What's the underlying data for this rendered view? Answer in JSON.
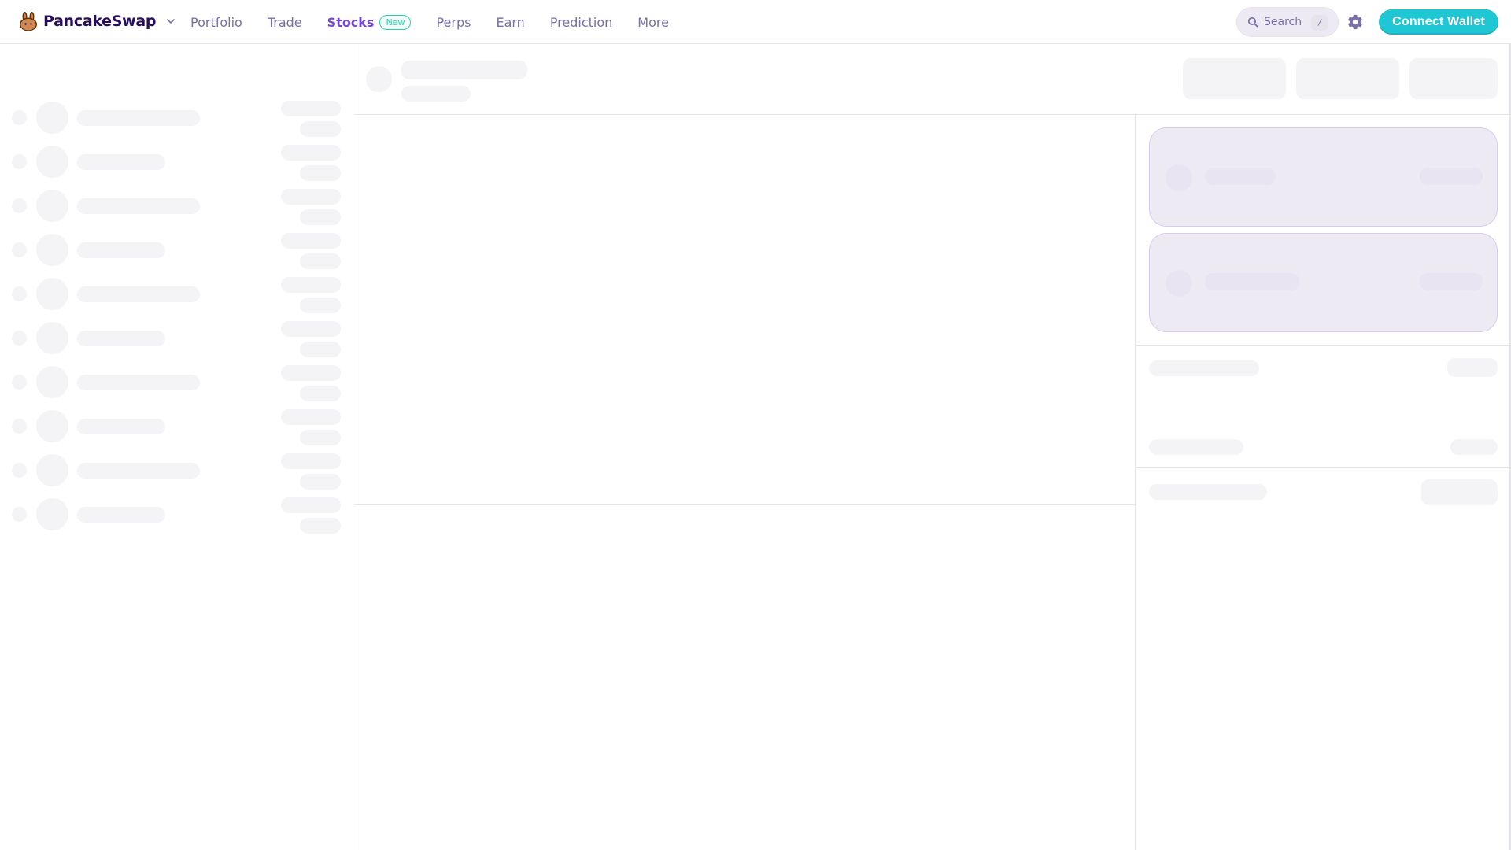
{
  "app": {
    "brand": "PancakeSwap",
    "accent_color": "#7645d9",
    "brand_color": "#1fc7d4",
    "text_color": "#280d5f",
    "muted_color": "#7a6eaa"
  },
  "nav": {
    "items": [
      {
        "label": "Portfolio",
        "active": false
      },
      {
        "label": "Trade",
        "active": false
      },
      {
        "label": "Stocks",
        "active": true,
        "badge": "New"
      },
      {
        "label": "Perps",
        "active": false
      },
      {
        "label": "Earn",
        "active": false
      },
      {
        "label": "Prediction",
        "active": false
      },
      {
        "label": "More",
        "active": false
      }
    ]
  },
  "search": {
    "label": "Search",
    "shortcut": "/"
  },
  "connect_label": "Connect Wallet",
  "icons": {
    "logo": "bunny-logo-icon",
    "menu": "chevron-down-icon",
    "search": "search-icon",
    "settings": "gear-icon"
  },
  "state": "loading"
}
